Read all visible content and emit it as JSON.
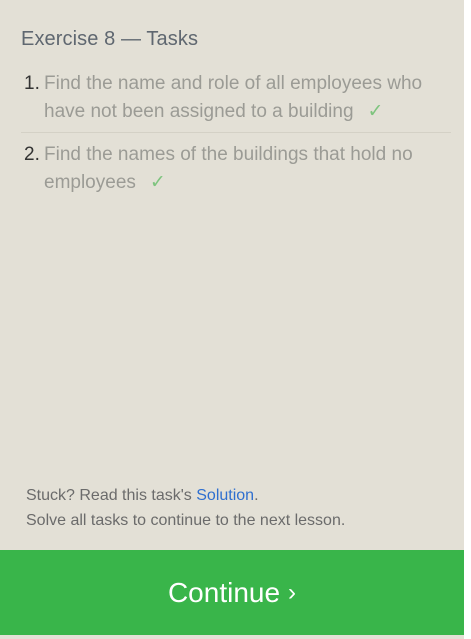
{
  "panel": {
    "title": "Exercise 8 — Tasks"
  },
  "tasks": [
    {
      "number": "1.",
      "text": "Find the name and role of all employees who have not been assigned to a building",
      "check": "✓"
    },
    {
      "number": "2.",
      "text": "Find the names of the buildings that hold no employees",
      "check": "✓"
    }
  ],
  "footer": {
    "stuck_prefix": "Stuck? Read this task's ",
    "solution_link": "Solution",
    "stuck_suffix": ".",
    "instruction": "Solve all tasks to continue to the next lesson."
  },
  "continue_button": {
    "label": "Continue",
    "arrow": "›"
  },
  "colors": {
    "panel_background": "#e3e0d6",
    "continue_green": "#39b54a",
    "check_green": "#7ec47e",
    "link_blue": "#2f6fcf"
  }
}
